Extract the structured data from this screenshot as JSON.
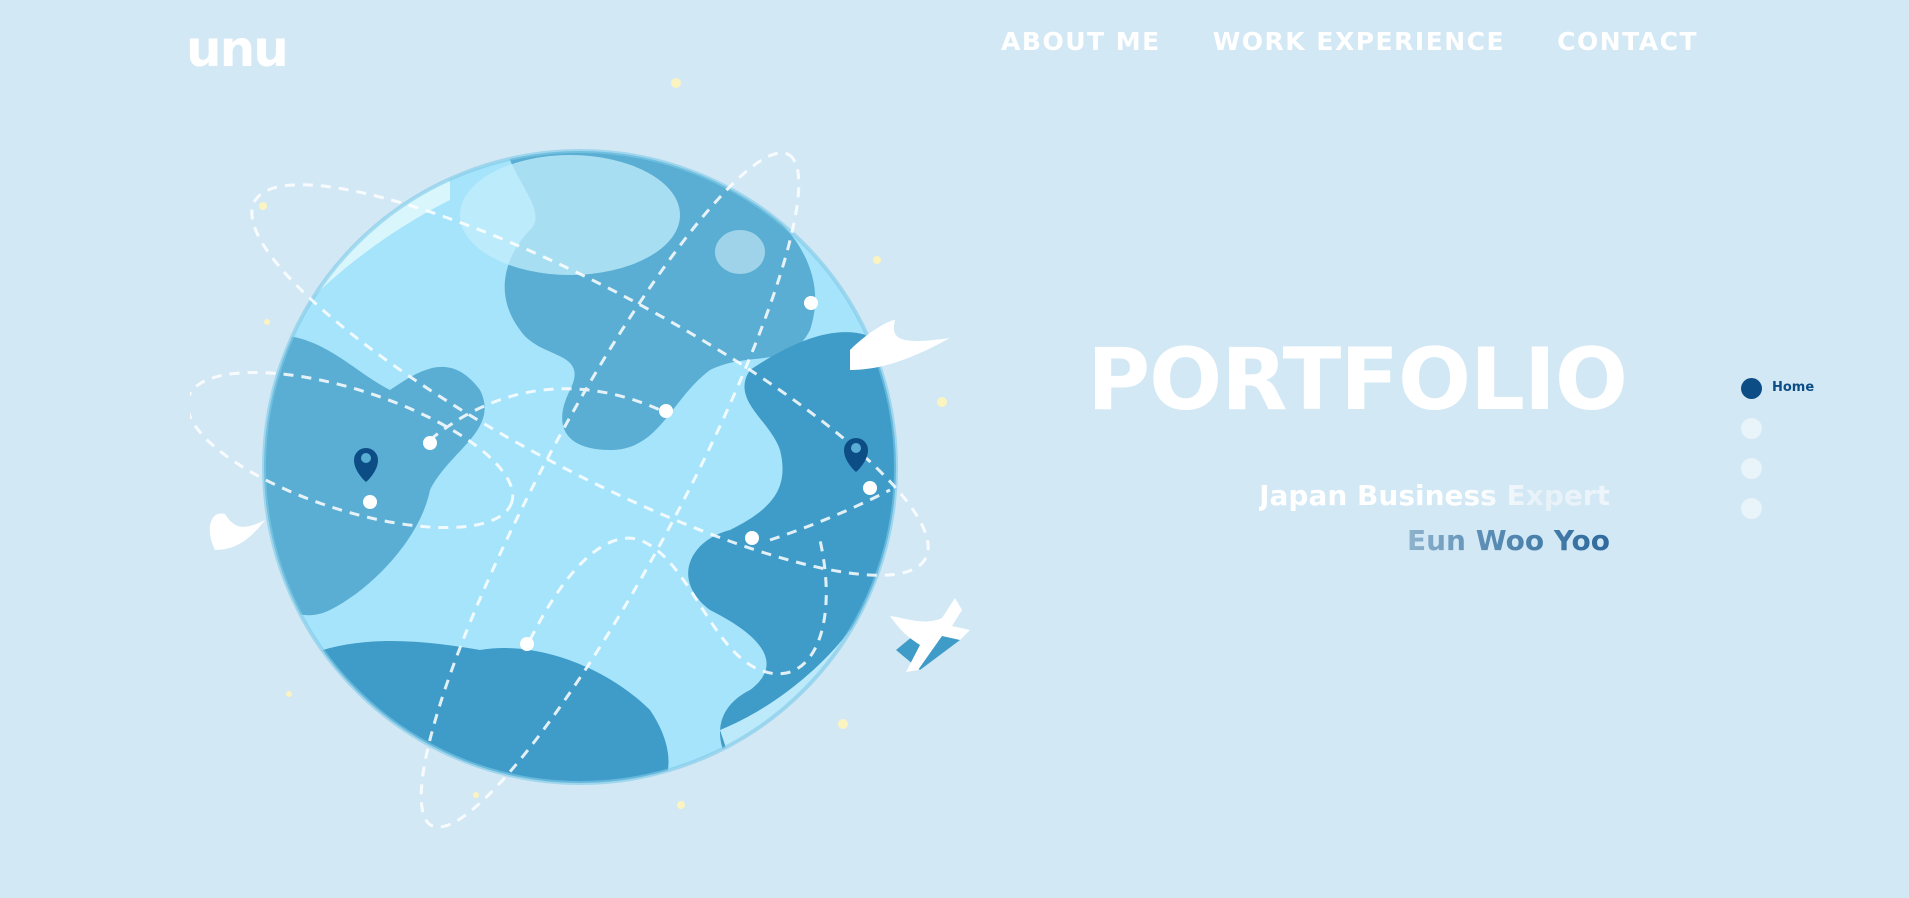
{
  "header": {
    "logo_text": "unu",
    "nav": [
      {
        "label": "ABOUT ME"
      },
      {
        "label": "WORK EXPERIENCE"
      },
      {
        "label": "CONTACT"
      }
    ]
  },
  "hero": {
    "title": "PORTFOLIO",
    "subtitle": "Japan Business Expert",
    "name": "Eun Woo Yoo"
  },
  "pager": {
    "active_label": "Home",
    "total": 4,
    "active_index": 0
  },
  "illustration": {
    "icons": [
      "globe-icon",
      "airplane-icon",
      "map-pin-icon",
      "bird-icon",
      "star-icon"
    ]
  },
  "colors": {
    "background": "#d2e8f5",
    "ocean": "#a6e4fb",
    "land": "#5aaed3",
    "land_dark": "#3f9bc8",
    "accent": "#0d4d86",
    "text_light": "#ffffff"
  }
}
